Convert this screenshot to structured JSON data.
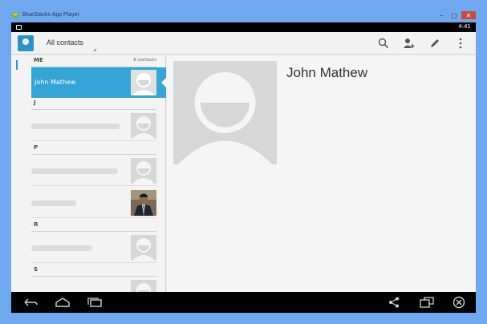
{
  "window": {
    "title": "BlueStacks App Player",
    "minimize_glyph": "‒",
    "maximize_glyph": "□",
    "close_glyph": "✕"
  },
  "statusbar": {
    "time": "4:41"
  },
  "actionbar": {
    "title": "All contacts",
    "icons": [
      "search-icon",
      "add-contact-icon",
      "edit-icon",
      "overflow-menu-icon"
    ]
  },
  "list": {
    "sections": [
      {
        "letter": "ME",
        "count": "8 contacts"
      },
      {
        "letter": "J"
      },
      {
        "letter": "P"
      },
      {
        "letter": "R"
      },
      {
        "letter": "S"
      }
    ],
    "selected_contact": "John Mathew"
  },
  "detail": {
    "name": "John Mathew"
  },
  "colors": {
    "accent": "#35a4d6",
    "desktop_bg": "#6fa8ee",
    "close_button": "#c94b3b"
  },
  "navbar": {
    "icons": [
      "back-icon",
      "home-icon",
      "recent-apps-icon",
      "share-icon",
      "screen-rotate-icon",
      "close-app-icon"
    ]
  }
}
